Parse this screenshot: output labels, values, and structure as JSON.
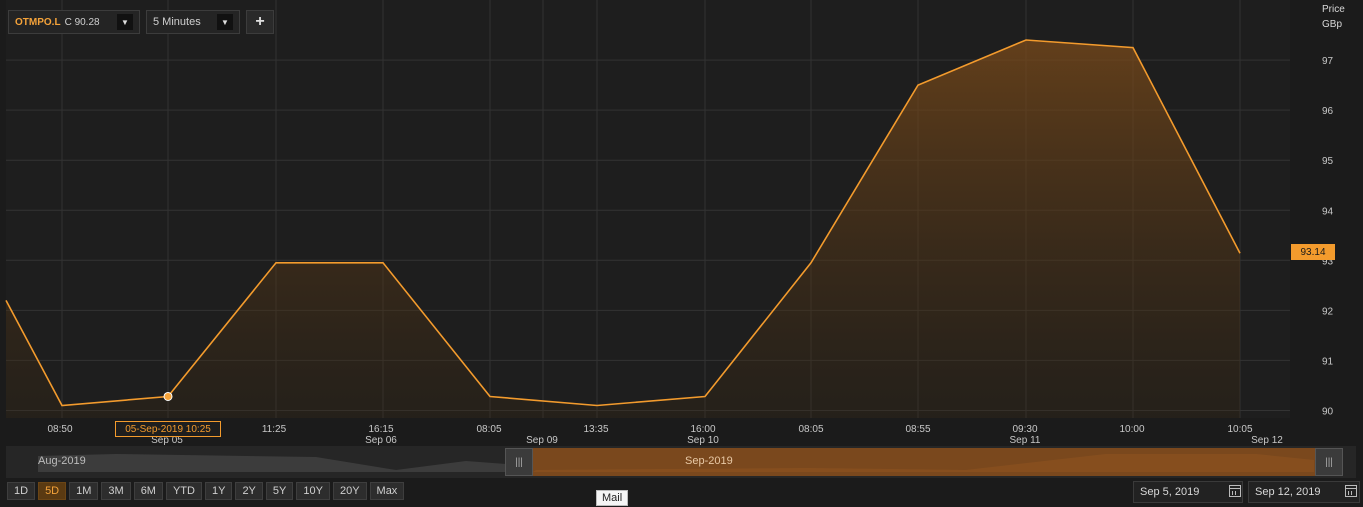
{
  "toolbar": {
    "ric_code": "OTMPO.L",
    "ric_close": "C 90.28",
    "interval": "5 Minutes",
    "add_label": "+"
  },
  "chart_data": {
    "type": "area",
    "categories": [
      "",
      "08:50",
      "10:25",
      "11:25",
      "16:15",
      "08:05",
      "13:35",
      "16:00",
      "08:05",
      "08:55",
      "09:30",
      "10:00",
      "10:05"
    ],
    "series": [
      {
        "values": [
          92.2,
          90.1,
          90.28,
          92.95,
          92.95,
          90.28,
          90.1,
          90.28,
          92.95,
          96.5,
          97.4,
          97.25,
          93.14
        ]
      }
    ],
    "x_tick_labels": [
      {
        "time": "08:50",
        "date": ""
      },
      {
        "time": "",
        "date": "Sep 05"
      },
      {
        "time": "11:25",
        "date": ""
      },
      {
        "time": "16:15",
        "date": "Sep 06"
      },
      {
        "time": "08:05",
        "date": ""
      },
      {
        "time": "",
        "date": "Sep 09"
      },
      {
        "time": "13:35",
        "date": ""
      },
      {
        "time": "16:00",
        "date": "Sep 10"
      },
      {
        "time": "08:05",
        "date": ""
      },
      {
        "time": "08:55",
        "date": ""
      },
      {
        "time": "09:30",
        "date": "Sep 11"
      },
      {
        "time": "10:00",
        "date": ""
      },
      {
        "time": "10:05",
        "date": ""
      },
      {
        "time": "",
        "date": "Sep 12"
      }
    ],
    "y_ticks": [
      90,
      91,
      92,
      93,
      94,
      95,
      96,
      97
    ],
    "ylim": [
      89.85,
      98.2
    ],
    "ylabel_line1": "Price",
    "ylabel_line2": "GBp",
    "last_value": "93.14",
    "cursor_label": "05-Sep-2019 10:25",
    "grid": true,
    "line_color": "#f39b2d",
    "fill_color": "#7a4a1a"
  },
  "navigator": {
    "left_label": "Aug-2019",
    "window_label": "Sep-2019"
  },
  "periods": [
    {
      "label": "1D",
      "active": false
    },
    {
      "label": "5D",
      "active": true
    },
    {
      "label": "1M",
      "active": false
    },
    {
      "label": "3M",
      "active": false
    },
    {
      "label": "6M",
      "active": false
    },
    {
      "label": "YTD",
      "active": false
    },
    {
      "label": "1Y",
      "active": false
    },
    {
      "label": "2Y",
      "active": false
    },
    {
      "label": "5Y",
      "active": false
    },
    {
      "label": "10Y",
      "active": false
    },
    {
      "label": "20Y",
      "active": false
    },
    {
      "label": "Max",
      "active": false
    }
  ],
  "date_range": {
    "start": "Sep 5, 2019",
    "end": "Sep 12, 2019"
  },
  "tooltip": "Mail"
}
